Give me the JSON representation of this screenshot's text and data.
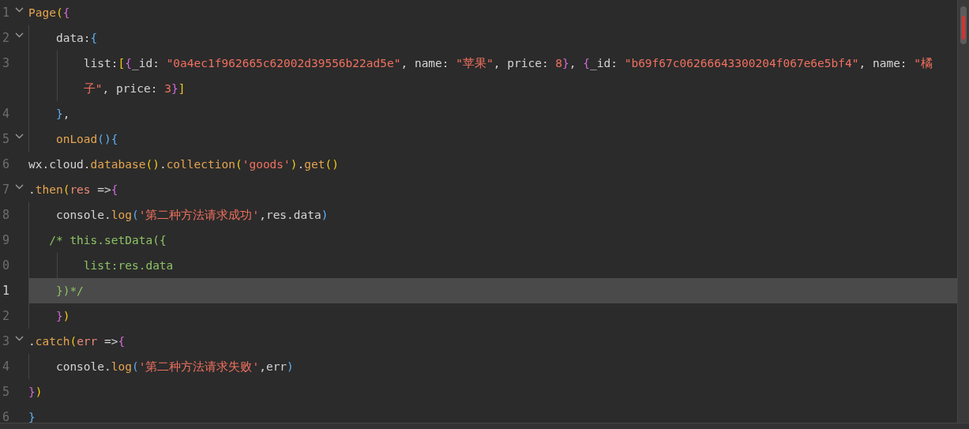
{
  "editor": {
    "lines": [
      {
        "number": "1",
        "foldable": true,
        "current": false,
        "rows": [
          "Page({"
        ]
      },
      {
        "number": "2",
        "foldable": true,
        "current": false,
        "rows": [
          "    data:{"
        ]
      },
      {
        "number": "3",
        "foldable": false,
        "current": false,
        "rows": [
          "        list:[{_id: \"0a4ec1f962665c62002d39556b22ad5e\", name: \"苹果\", price: 8}, {_id: \"b69f67c06266643300204f067e6e5bf4\", name: \"橘",
          "        子\", price: 3}]"
        ]
      },
      {
        "number": "4",
        "foldable": false,
        "current": false,
        "rows": [
          "    },"
        ]
      },
      {
        "number": "5",
        "foldable": true,
        "current": false,
        "rows": [
          "    onLoad(){"
        ]
      },
      {
        "number": "6",
        "foldable": false,
        "current": false,
        "rows": [
          "wx.cloud.database().collection('goods').get()"
        ]
      },
      {
        "number": "7",
        "foldable": true,
        "current": false,
        "rows": [
          ".then(res =>{"
        ]
      },
      {
        "number": "8",
        "foldable": false,
        "current": false,
        "rows": [
          "    console.log('第二种方法请求成功',res.data)"
        ]
      },
      {
        "number": "9",
        "foldable": false,
        "current": false,
        "rows": [
          "   /* this.setData({"
        ]
      },
      {
        "number": "0",
        "foldable": false,
        "current": false,
        "rows": [
          "        list:res.data"
        ]
      },
      {
        "number": "1",
        "foldable": false,
        "current": true,
        "rows": [
          "    })*/"
        ]
      },
      {
        "number": "2",
        "foldable": false,
        "current": false,
        "rows": [
          "    })"
        ]
      },
      {
        "number": "3",
        "foldable": true,
        "current": false,
        "rows": [
          ".catch(err =>{"
        ]
      },
      {
        "number": "4",
        "foldable": false,
        "current": false,
        "rows": [
          "    console.log('第二种方法请求失败',err)"
        ]
      },
      {
        "number": "5",
        "foldable": false,
        "current": false,
        "rows": [
          "})"
        ]
      },
      {
        "number": "6",
        "foldable": false,
        "current": false,
        "rows": [
          "}"
        ]
      }
    ]
  }
}
